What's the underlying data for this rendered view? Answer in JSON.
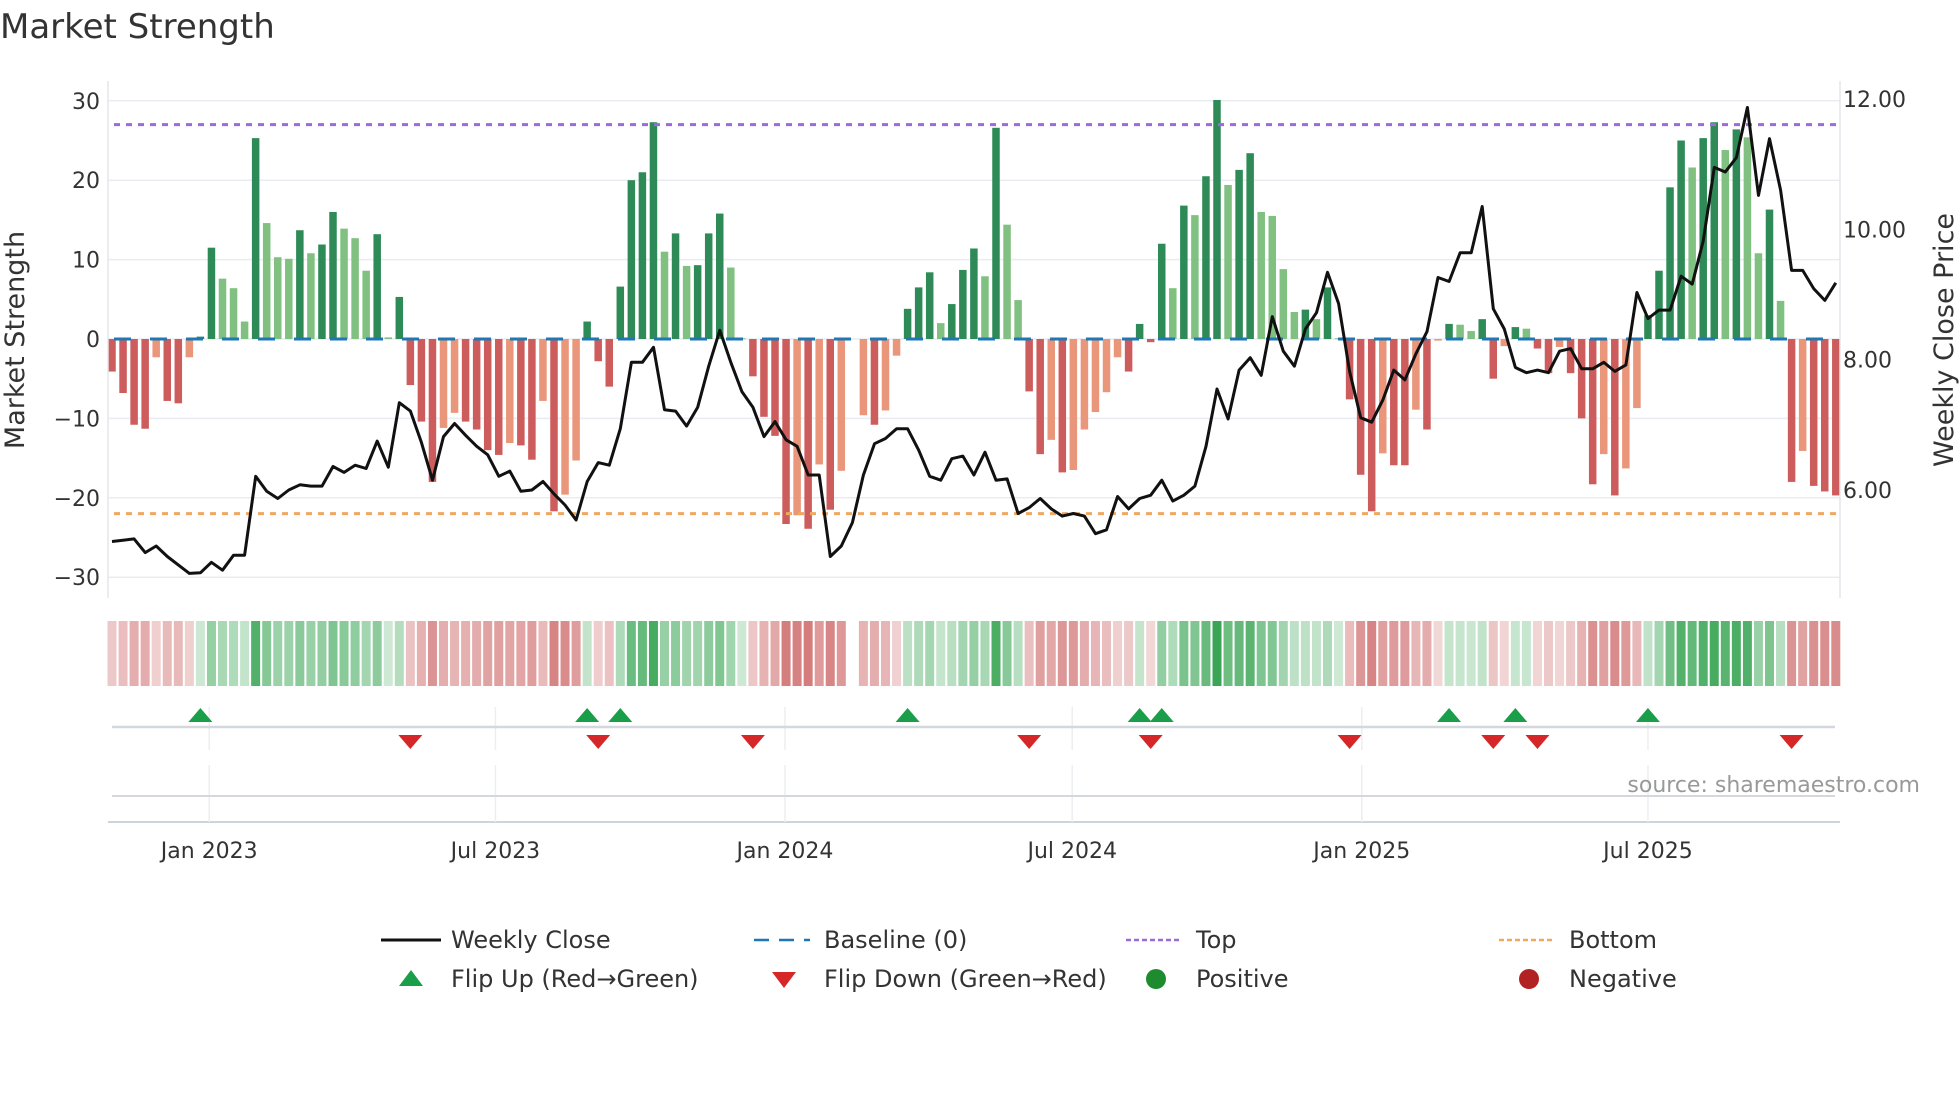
{
  "chart_data": {
    "type": "bar",
    "title": "Market Strength",
    "ylabel": "Market Strength",
    "y2label": "Weekly Close Price",
    "ylim": [
      -33,
      33
    ],
    "y2lim": [
      4.0,
      12.3
    ],
    "yticks": [
      "30",
      "20",
      "10",
      "0",
      "−10",
      "−20",
      "−30"
    ],
    "ytick_values": [
      30,
      20,
      10,
      0,
      -10,
      -20,
      -30
    ],
    "y2ticks": [
      "12.00",
      "10.00",
      "8.00",
      "6.00"
    ],
    "y2tick_values": [
      12,
      10,
      8,
      6
    ],
    "xticks": [
      {
        "label": "Jan 2023",
        "week": 8.8
      },
      {
        "label": "Jul 2023",
        "week": 34.7
      },
      {
        "label": "Jan 2024",
        "week": 60.9
      },
      {
        "label": "Jul 2024",
        "week": 86.9
      },
      {
        "label": "Jan 2025",
        "week": 113.1
      },
      {
        "label": "Jul 2025",
        "week": 139.0
      }
    ],
    "top_level": 27,
    "bottom_level": -22,
    "baseline": 0,
    "strength": [
      -4.1,
      -6.8,
      -10.8,
      -11.3,
      -2.3,
      -7.8,
      -8.1,
      -2.3,
      0.3,
      11.5,
      7.6,
      6.4,
      2.2,
      25.3,
      14.6,
      10.3,
      10.1,
      13.7,
      10.8,
      11.9,
      16.0,
      13.9,
      12.7,
      8.6,
      13.2,
      0.2,
      5.3,
      -5.8,
      -10.4,
      -18.0,
      -11.2,
      -9.3,
      -10.4,
      -11.4,
      -14.0,
      -14.6,
      -13.1,
      -13.4,
      -15.2,
      -7.8,
      -21.7,
      -19.6,
      -15.3,
      2.2,
      -2.8,
      -6.0,
      6.6,
      20.0,
      21.0,
      27.3,
      11.0,
      13.3,
      9.2,
      9.3,
      13.3,
      15.8,
      9.0,
      0.1,
      -4.7,
      -9.8,
      -12.2,
      -23.3,
      -22.2,
      -23.9,
      -15.8,
      -21.5,
      -16.6,
      null,
      -9.6,
      -10.8,
      -9.0,
      -2.1,
      3.8,
      6.5,
      8.4,
      2.0,
      4.4,
      8.7,
      11.4,
      7.9,
      26.6,
      14.4,
      4.9,
      -6.6,
      -14.5,
      -12.7,
      -16.8,
      -16.5,
      -11.4,
      -9.2,
      -6.7,
      -2.3,
      -4.1,
      1.9,
      -0.4,
      12.0,
      6.4,
      16.8,
      15.6,
      20.5,
      30.1,
      19.4,
      21.3,
      23.4,
      16.0,
      15.5,
      8.8,
      3.4,
      3.7,
      2.5,
      6.5,
      0.1,
      -7.6,
      -17.1,
      -21.7,
      -14.4,
      -15.9,
      -15.9,
      -8.9,
      -11.4,
      -0.2,
      1.9,
      1.8,
      1.0,
      2.5,
      -5.0,
      -0.9,
      1.5,
      1.3,
      -1.2,
      -4.3,
      -1.0,
      -4.3,
      -10.0,
      -18.3,
      -14.5,
      -19.7,
      -16.3,
      -8.7,
      3.0,
      8.6,
      19.1,
      25.0,
      21.6,
      25.3,
      27.3,
      23.8,
      26.4,
      25.4,
      10.8,
      16.3,
      4.8,
      -18.0,
      -14.1,
      -18.5,
      -19.2,
      -19.7
    ],
    "weekly_close": [
      5.21,
      5.23,
      5.25,
      5.04,
      5.14,
      4.98,
      4.85,
      4.72,
      4.73,
      4.89,
      4.77,
      5.0,
      5.0,
      6.21,
      5.98,
      5.87,
      6.0,
      6.08,
      6.06,
      6.06,
      6.36,
      6.27,
      6.38,
      6.33,
      6.75,
      6.35,
      7.34,
      7.21,
      6.73,
      6.15,
      6.82,
      7.02,
      6.84,
      6.67,
      6.54,
      6.21,
      6.29,
      5.98,
      6.0,
      6.13,
      5.94,
      5.77,
      5.54,
      6.13,
      6.42,
      6.38,
      6.94,
      7.96,
      7.96,
      8.19,
      7.23,
      7.21,
      6.98,
      7.27,
      7.9,
      8.45,
      7.96,
      7.51,
      7.27,
      6.82,
      7.05,
      6.77,
      6.67,
      6.23,
      6.23,
      4.98,
      5.14,
      5.5,
      6.23,
      6.71,
      6.79,
      6.94,
      6.94,
      6.61,
      6.21,
      6.15,
      6.48,
      6.52,
      6.23,
      6.58,
      6.15,
      6.17,
      5.64,
      5.73,
      5.87,
      5.71,
      5.6,
      5.64,
      5.6,
      5.33,
      5.39,
      5.9,
      5.71,
      5.87,
      5.92,
      6.15,
      5.83,
      5.92,
      6.06,
      6.67,
      7.55,
      7.09,
      7.84,
      8.03,
      7.76,
      8.66,
      8.13,
      7.9,
      8.47,
      8.72,
      9.34,
      8.86,
      7.82,
      7.11,
      7.04,
      7.38,
      7.84,
      7.69,
      8.09,
      8.43,
      9.26,
      9.2,
      9.64,
      9.64,
      10.35,
      8.78,
      8.47,
      7.88,
      7.8,
      7.84,
      7.8,
      8.13,
      8.17,
      7.86,
      7.86,
      7.96,
      7.82,
      7.92,
      9.03,
      8.63,
      8.76,
      8.76,
      9.28,
      9.16,
      9.82,
      10.95,
      10.88,
      11.1,
      11.87,
      10.52,
      11.39,
      10.6,
      9.37,
      9.37,
      9.09,
      8.91,
      9.18
    ],
    "flip_up_weeks": [
      8,
      43,
      46,
      72,
      93,
      95,
      121,
      127,
      139
    ],
    "flip_down_weeks": [
      27,
      44,
      58,
      83,
      94,
      112,
      125,
      129,
      152
    ],
    "legend_placement": "bottom",
    "legend": [
      {
        "label": "Weekly Close",
        "symbol": "line"
      },
      {
        "label": "Baseline (0)",
        "symbol": "dash"
      },
      {
        "label": "Top",
        "symbol": "dot-purple"
      },
      {
        "label": "Bottom",
        "symbol": "dot-orange"
      },
      {
        "label": "Flip Up (Red→Green)",
        "symbol": "triangle-up"
      },
      {
        "label": "Flip Down (Green→Red)",
        "symbol": "triangle-down"
      },
      {
        "label": "Positive",
        "symbol": "circle-green"
      },
      {
        "label": "Negative",
        "symbol": "circle-red"
      }
    ],
    "source": "source: sharemaestro.com"
  },
  "colors": {
    "up_strong": "#2e8b57",
    "up_weak": "#80c080",
    "down_strong": "#cd5c5c",
    "down_weak": "#e9967a",
    "close": "#111111",
    "baseline": "#1f77b4",
    "top": "#9b6bd8",
    "bottom": "#f0a860",
    "flip_up": "#1a9e4a",
    "flip_down": "#d62728",
    "positive": "#1e8c2e",
    "negative": "#b22222"
  }
}
